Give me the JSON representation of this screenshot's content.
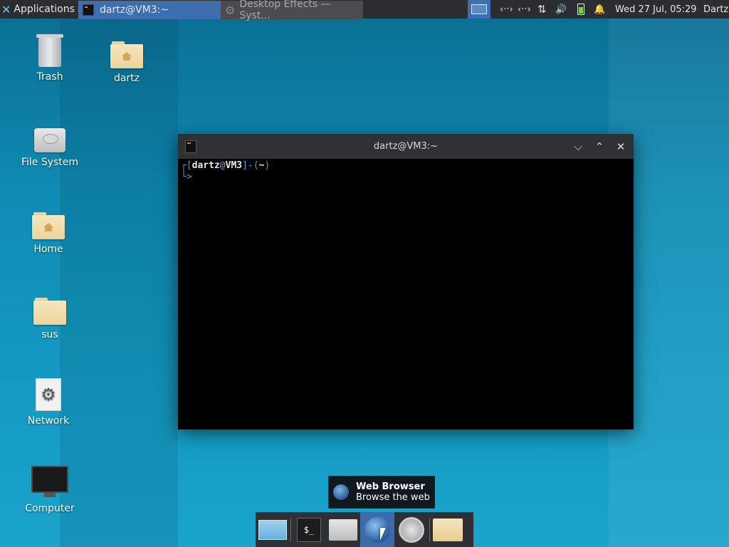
{
  "panel": {
    "applications_label": "Applications",
    "tasks": [
      {
        "label": "dartz@VM3:~",
        "active": true
      },
      {
        "label": "Desktop Effects — Syst...",
        "active": false
      }
    ],
    "tray": {
      "net1": "‹··›",
      "net2": "‹··›",
      "updown": "⇅",
      "volume": "🔊",
      "bell": "🔔"
    },
    "clock": "Wed 27 Jul, 05:29",
    "user": "Dartz"
  },
  "desktop": {
    "icons": [
      {
        "label": "Trash"
      },
      {
        "label": "dartz"
      },
      {
        "label": "File System"
      },
      {
        "label": "Home"
      },
      {
        "label": "sus"
      },
      {
        "label": "Network"
      },
      {
        "label": "Computer"
      }
    ]
  },
  "terminal": {
    "title": "dartz@VM3:~",
    "prompt_open": "┌[",
    "user": "dartz",
    "at": "@",
    "host": "VM3",
    "prompt_mid": "]-(",
    "cwd": "~",
    "prompt_close": ")",
    "prompt_line2": "└>"
  },
  "tooltip": {
    "title": "Web Browser",
    "subtitle": "Browse the web"
  },
  "dock": {
    "terminal_glyph": "$_"
  }
}
